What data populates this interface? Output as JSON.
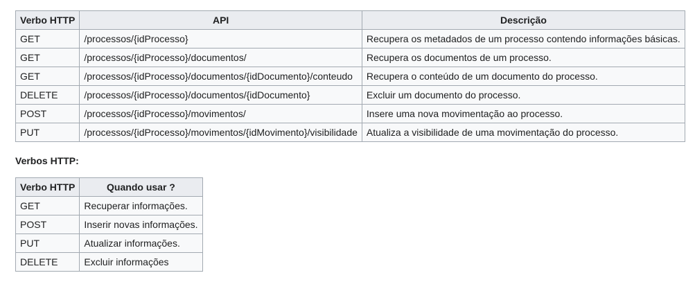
{
  "api_table": {
    "headers": [
      "Verbo HTTP",
      "API",
      "Descrição"
    ],
    "rows": [
      [
        "GET",
        "/processos/{idProcesso}",
        "Recupera os metadados de um processo contendo informações básicas."
      ],
      [
        "GET",
        "/processos/{idProcesso}/documentos/",
        "Recupera os documentos de um processo."
      ],
      [
        "GET",
        "/processos/{idProcesso}/documentos/{idDocumento}/conteudo",
        "Recupera o conteúdo de um documento do processo."
      ],
      [
        "DELETE",
        "/processos/{idProcesso}/documentos/{idDocumento}",
        "Excluir um documento do processo."
      ],
      [
        "POST",
        "/processos/{idProcesso}/movimentos/",
        "Insere uma nova movimentação ao processo."
      ],
      [
        "PUT",
        "/processos/{idProcesso}/movimentos/{idMovimento}/visibilidade",
        "Atualiza a visibilidade de uma movimentação do processo."
      ]
    ]
  },
  "section_title": "Verbos HTTP:",
  "verbs_table": {
    "headers": [
      "Verbo HTTP",
      "Quando usar ?"
    ],
    "rows": [
      [
        "GET",
        "Recuperar informações."
      ],
      [
        "POST",
        "Inserir novas informações."
      ],
      [
        "PUT",
        "Atualizar informações."
      ],
      [
        "DELETE",
        "Excluir informações"
      ]
    ]
  }
}
